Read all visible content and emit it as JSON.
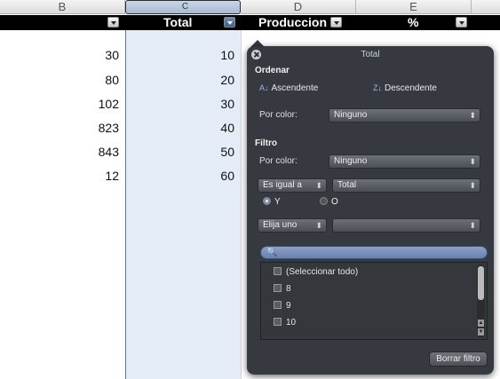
{
  "columns": {
    "b": "B",
    "c": "C",
    "d": "D",
    "e": "E"
  },
  "header_row": {
    "total": "Total",
    "produccion": "Produccion",
    "percent": "%"
  },
  "column_b_values": [
    "30",
    "80",
    "102",
    "823",
    "843",
    "12"
  ],
  "column_c_values": [
    "10",
    "20",
    "30",
    "40",
    "50",
    "60"
  ],
  "filter_popover": {
    "title": "Total",
    "sort_section": "Ordenar",
    "sort_asc": "Ascendente",
    "sort_desc": "Descendente",
    "sort_by_color_label": "Por color:",
    "sort_by_color_value": "Ninguno",
    "filter_section": "Filtro",
    "filter_by_color_label": "Por color:",
    "filter_by_color_value": "Ninguno",
    "condition_operator": "Es igual a",
    "condition_value": "Total",
    "radio_and": "Y",
    "radio_or": "O",
    "second_operator": "Elija uno",
    "second_value": "",
    "search_placeholder": "",
    "list_items": [
      "(Seleccionar todo)",
      "8",
      "9",
      "10"
    ],
    "clear_button": "Borrar filtro"
  },
  "colors": {
    "popover_bg": "#2e3238",
    "selected_column": "#e4ecf7",
    "header_row": "#000000"
  }
}
